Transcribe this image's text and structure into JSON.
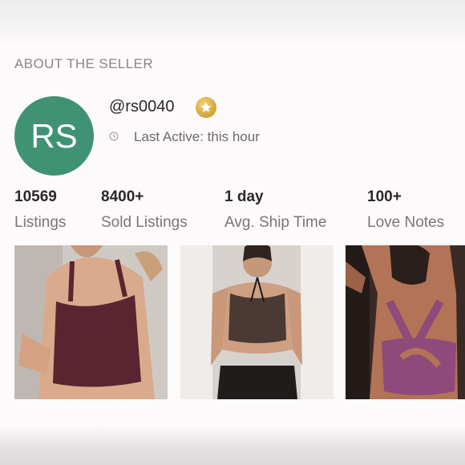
{
  "section_title": "ABOUT THE SELLER",
  "seller": {
    "initials": "RS",
    "username": "@rs0040",
    "badge_icon": "star-icon",
    "last_active": "Last Active: this hour",
    "avatar_color": "#3f9374"
  },
  "stats": [
    {
      "value": "10569",
      "label": "Listings"
    },
    {
      "value": "8400+",
      "label": "Sold Listings"
    },
    {
      "value": "1 day",
      "label": "Avg. Ship Time"
    },
    {
      "value": "100+",
      "label": "Love Notes"
    }
  ],
  "photos": [
    {
      "subject": "maroon-crop-top-photo",
      "color": "#5a2430"
    },
    {
      "subject": "brown-bralette-photo",
      "color": "#4a3a33"
    },
    {
      "subject": "purple-crossback-bra-photo",
      "color": "#8d4a7a"
    }
  ]
}
